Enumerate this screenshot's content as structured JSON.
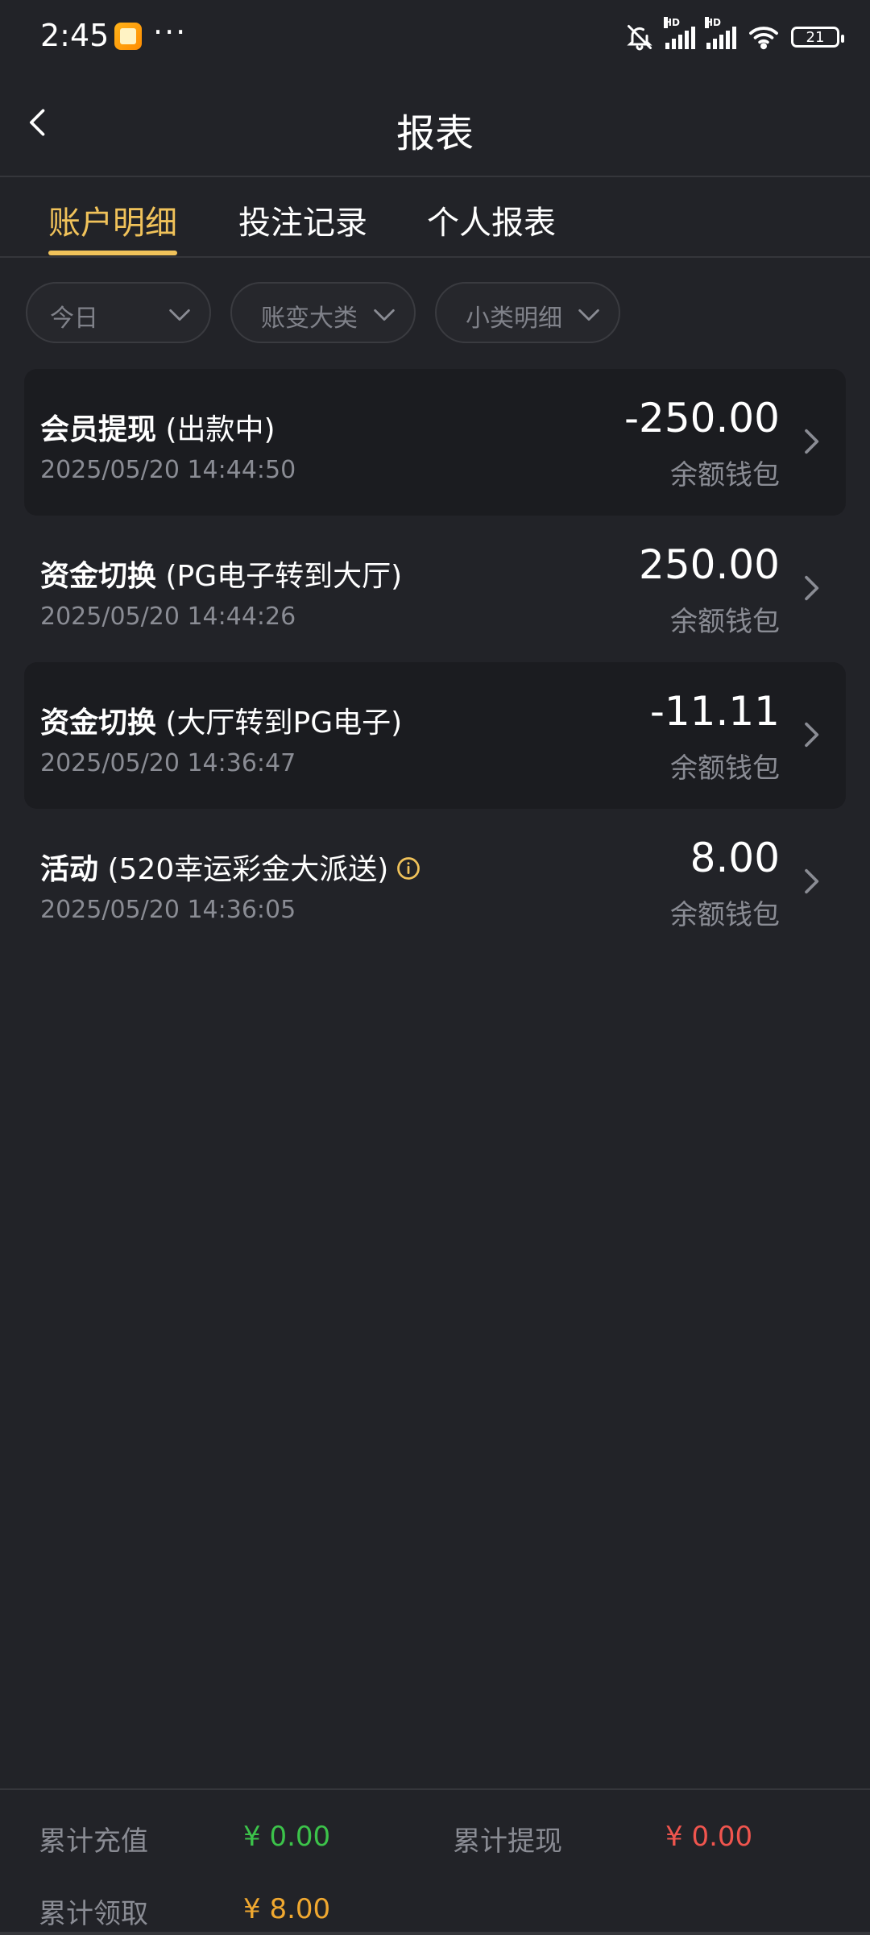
{
  "status_bar": {
    "time": "2:45",
    "dots": "···",
    "battery": "21",
    "hd_label": "HD"
  },
  "header": {
    "title": "报表"
  },
  "tabs": [
    {
      "label": "账户明细",
      "active": true
    },
    {
      "label": "投注记录",
      "active": false
    },
    {
      "label": "个人报表",
      "active": false
    }
  ],
  "filters": [
    {
      "label": "今日"
    },
    {
      "label": "账变大类"
    },
    {
      "label": "小类明细"
    }
  ],
  "records": [
    {
      "title": "会员提现",
      "detail": "(出款中)",
      "time": "2025/05/20 14:44:50",
      "amount": "-250.00",
      "wallet": "余额钱包"
    },
    {
      "title": "资金切换",
      "detail": "(PG电子转到大厅)",
      "time": "2025/05/20 14:44:26",
      "amount": "250.00",
      "wallet": "余额钱包"
    },
    {
      "title": "资金切换",
      "detail": "(大厅转到PG电子)",
      "time": "2025/05/20 14:36:47",
      "amount": "-11.11",
      "wallet": "余额钱包"
    },
    {
      "title": "活动",
      "detail": "(520幸运彩金大派送)",
      "time": "2025/05/20 14:36:05",
      "amount": "8.00",
      "wallet": "余额钱包"
    }
  ],
  "footer": {
    "total_recharge_label": "累计充值",
    "total_recharge_value": "¥ 0.00",
    "total_withdraw_label": "累计提现",
    "total_withdraw_value": "¥ 0.00",
    "total_claim_label": "累计领取",
    "total_claim_value": "¥ 8.00"
  },
  "colors": {
    "background": "#222328",
    "accent": "#f0c25a",
    "recharge": "#3cc34a",
    "withdraw": "#f0554e",
    "claim": "#f0a830"
  },
  "icons": {
    "back": "chevron-left-icon",
    "dropdown": "chevron-down-icon",
    "row_arrow": "chevron-right-icon",
    "info": "info-icon"
  }
}
